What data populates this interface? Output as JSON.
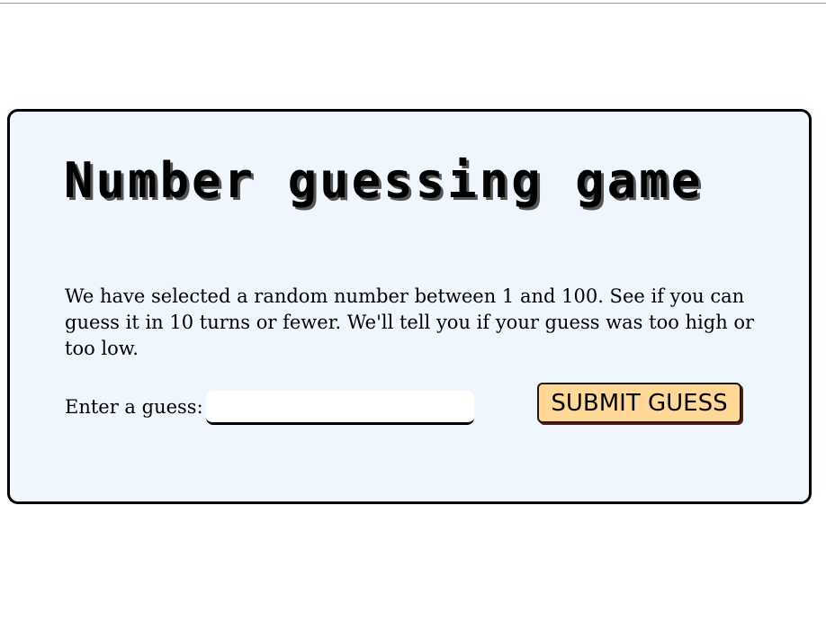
{
  "game": {
    "title": "Number guessing game",
    "description": "We have selected a random number between 1 and 100. See if you can guess it in 10 turns or fewer. We'll tell you if your guess was too high or too low.",
    "guess_label": "Enter a guess:",
    "guess_value": "",
    "submit_label": "SUBMIT GUESS"
  },
  "colors": {
    "card_background": "#eff6fe",
    "card_border": "#000000",
    "button_background": "#ffd898",
    "button_shadow": "#5a1e14",
    "top_rule": "#c8915c"
  }
}
